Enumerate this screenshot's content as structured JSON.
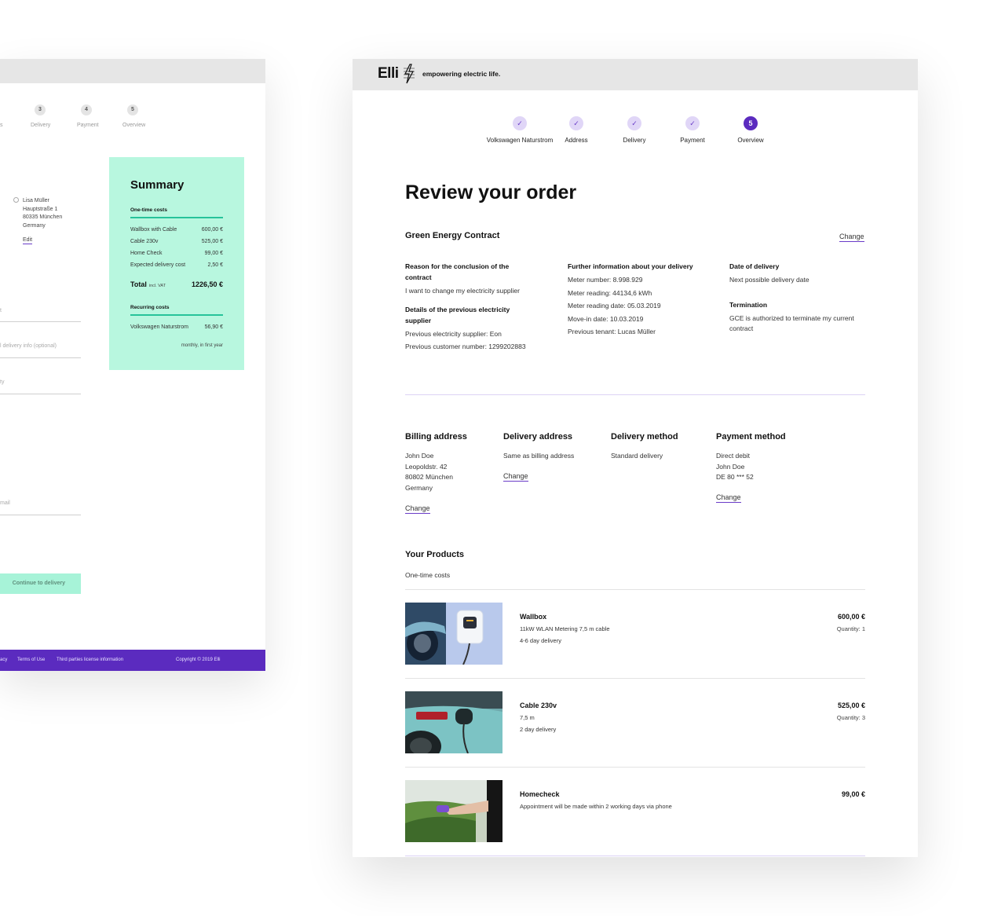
{
  "left_window": {
    "steps": [
      {
        "num": "",
        "label": "s"
      },
      {
        "num": "3",
        "label": "Delivery"
      },
      {
        "num": "4",
        "label": "Payment"
      },
      {
        "num": "5",
        "label": "Overview"
      }
    ],
    "address": [
      "Lisa Müller",
      "Hauptstraße 1",
      "80335 München",
      "Germany"
    ],
    "edit_label": "Edit",
    "fields": [
      {
        "placeholder": "t"
      },
      {
        "placeholder": "l delivery info (optional)"
      },
      {
        "placeholder": "ty"
      },
      {
        "placeholder": "mail"
      }
    ],
    "continue_label": "Continue to delivery",
    "footer": {
      "privacy": "acy",
      "terms": "Terms of Use",
      "third_party": "Third parties license information",
      "copyright": "Copyright © 2019 Elli"
    },
    "summary": {
      "title": "Summary",
      "one_time_heading": "One-time costs",
      "one_time_items": [
        {
          "label": "Wallbox with Cable",
          "value": "600,00 €"
        },
        {
          "label": "Cable 230v",
          "value": "525,00 €"
        },
        {
          "label": "Home Check",
          "value": "99,00 €"
        },
        {
          "label": "Expected delivery cost",
          "value": "2,50 €"
        }
      ],
      "total_label": "Total",
      "total_note": "incl. VAT",
      "total_value": "1226,50 €",
      "recurring_heading": "Recurring costs",
      "recurring_item": {
        "label": "Volkswagen Naturstrom",
        "value": "56,90 €"
      },
      "recurring_note": "monthly, in first year"
    }
  },
  "header": {
    "logo": "Elli",
    "tagline": "empowering electric life."
  },
  "steps": [
    {
      "label": "Volkswagen Naturstrom",
      "mark": "✓"
    },
    {
      "label": "Address",
      "mark": "✓"
    },
    {
      "label": "Delivery",
      "mark": "✓"
    },
    {
      "label": "Payment",
      "mark": "✓"
    },
    {
      "label": "Overview",
      "mark": "5"
    }
  ],
  "page_title": "Review your order",
  "contract": {
    "title": "Green Energy Contract",
    "change_label": "Change",
    "reason_heading": "Reason for the conclusion of the contract",
    "reason_text": "I want to change my electricity supplier",
    "previous_heading": "Details of the previous electricity supplier",
    "previous_supplier": "Previous electricity supplier: Eon",
    "previous_customer": "Previous customer number: 1299202883",
    "further_heading": "Further information about your delivery",
    "meter_number": "Meter number: 8.998.929",
    "meter_reading": "Meter reading: 44134,6 kWh",
    "meter_reading_date": "Meter reading date: 05.03.2019",
    "move_in_date": "Move-in date: 10.03.2019",
    "previous_tenant": "Previous tenant: Lucas Müller",
    "date_heading": "Date of delivery",
    "date_text": "Next possible delivery date",
    "termination_heading": "Termination",
    "termination_text": "GCE is authorized to terminate my current contract"
  },
  "billing": {
    "heading": "Billing address",
    "lines": [
      "John Doe",
      "Leopoldstr. 42",
      "80802 München",
      "Germany"
    ],
    "change_label": "Change"
  },
  "delivery_address": {
    "heading": "Delivery address",
    "text": "Same as billing address",
    "change_label": "Change"
  },
  "delivery_method": {
    "heading": "Delivery method",
    "text": "Standard delivery"
  },
  "payment": {
    "heading": "Payment method",
    "lines": [
      "Direct debit",
      "John Doe",
      "DE 80 *** 52"
    ],
    "change_label": "Change"
  },
  "products": {
    "heading": "Your Products",
    "subheading": "One-time costs",
    "items": [
      {
        "name": "Wallbox",
        "detail1": "11kW  WLAN  Metering 7,5 m cable",
        "detail2": "4-6 day delivery",
        "price": "600,00 €",
        "quantity": "Quantity: 1"
      },
      {
        "name": "Cable 230v",
        "detail1": "7,5 m",
        "detail2": "2 day delivery",
        "price": "525,00 €",
        "quantity": "Quantity: 3"
      },
      {
        "name": "Homecheck",
        "detail1": "Appointment will be made within 2 working days via phone",
        "detail2": "",
        "price": "99,00 €",
        "quantity": ""
      }
    ]
  }
}
